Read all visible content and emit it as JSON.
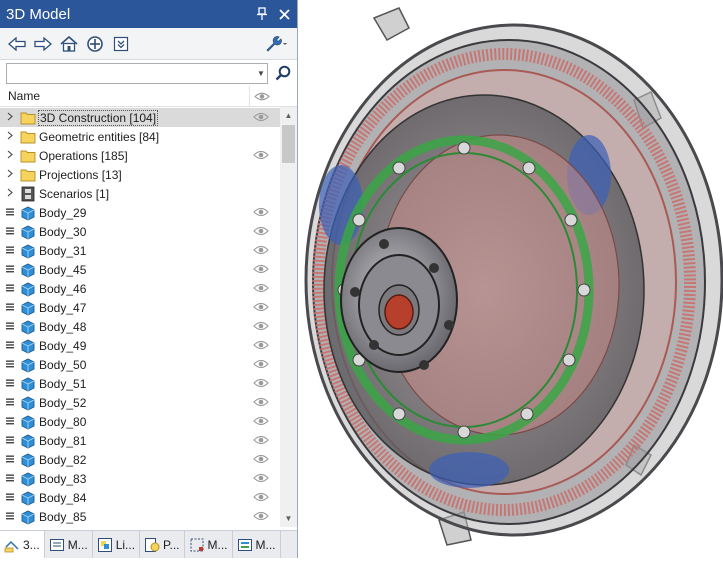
{
  "panel": {
    "title": "3D Model",
    "pin_glyph": "❙",
    "close_glyph": "✕"
  },
  "toolbar": {
    "icons": [
      "back-arrow-icon",
      "forward-arrow-icon",
      "home-icon",
      "target-icon",
      "filter-dropdown-icon",
      "wrench-settings-icon"
    ]
  },
  "search": {
    "value": "",
    "placeholder": ""
  },
  "tree": {
    "header_name": "Name",
    "rows": [
      {
        "label": "3D Construction [104]",
        "type": "folder",
        "eye": true,
        "selected": true
      },
      {
        "label": "Geometric entities [84]",
        "type": "folder",
        "eye": false
      },
      {
        "label": "Operations [185]",
        "type": "folder",
        "eye": true
      },
      {
        "label": "Projections [13]",
        "type": "folder",
        "eye": false
      },
      {
        "label": "Scenarios [1]",
        "type": "film",
        "eye": false
      },
      {
        "label": "Body_29",
        "type": "body",
        "eye": true
      },
      {
        "label": "Body_30",
        "type": "body",
        "eye": true
      },
      {
        "label": "Body_31",
        "type": "body",
        "eye": true
      },
      {
        "label": "Body_45",
        "type": "body",
        "eye": true
      },
      {
        "label": "Body_46",
        "type": "body",
        "eye": true
      },
      {
        "label": "Body_47",
        "type": "body",
        "eye": true
      },
      {
        "label": "Body_48",
        "type": "body",
        "eye": true
      },
      {
        "label": "Body_49",
        "type": "body",
        "eye": true
      },
      {
        "label": "Body_50",
        "type": "body",
        "eye": true
      },
      {
        "label": "Body_51",
        "type": "body",
        "eye": true
      },
      {
        "label": "Body_52",
        "type": "body",
        "eye": true
      },
      {
        "label": "Body_80",
        "type": "body",
        "eye": true
      },
      {
        "label": "Body_81",
        "type": "body",
        "eye": true
      },
      {
        "label": "Body_82",
        "type": "body",
        "eye": true
      },
      {
        "label": "Body_83",
        "type": "body",
        "eye": true
      },
      {
        "label": "Body_84",
        "type": "body",
        "eye": true
      },
      {
        "label": "Body_85",
        "type": "body",
        "eye": true
      }
    ]
  },
  "tabs": [
    {
      "label": "3...",
      "icon": "3d-model-tab-icon",
      "active": true
    },
    {
      "label": "M...",
      "icon": "list-tab-icon"
    },
    {
      "label": "Li...",
      "icon": "layers-tab-icon"
    },
    {
      "label": "P...",
      "icon": "properties-tab-icon"
    },
    {
      "label": "M...",
      "icon": "measure-tab-icon"
    },
    {
      "label": "M...",
      "icon": "macro-tab-icon"
    }
  ],
  "colors": {
    "title_bar": "#2b579a",
    "folder": "#f6d35c",
    "body_icon": "#2f8fd6",
    "gear_red": "#c9706b",
    "bearing_green": "#3aa645",
    "planet_blue": "#3a5fb8"
  },
  "viewport": {
    "content": "3d-gear-assembly-render"
  }
}
